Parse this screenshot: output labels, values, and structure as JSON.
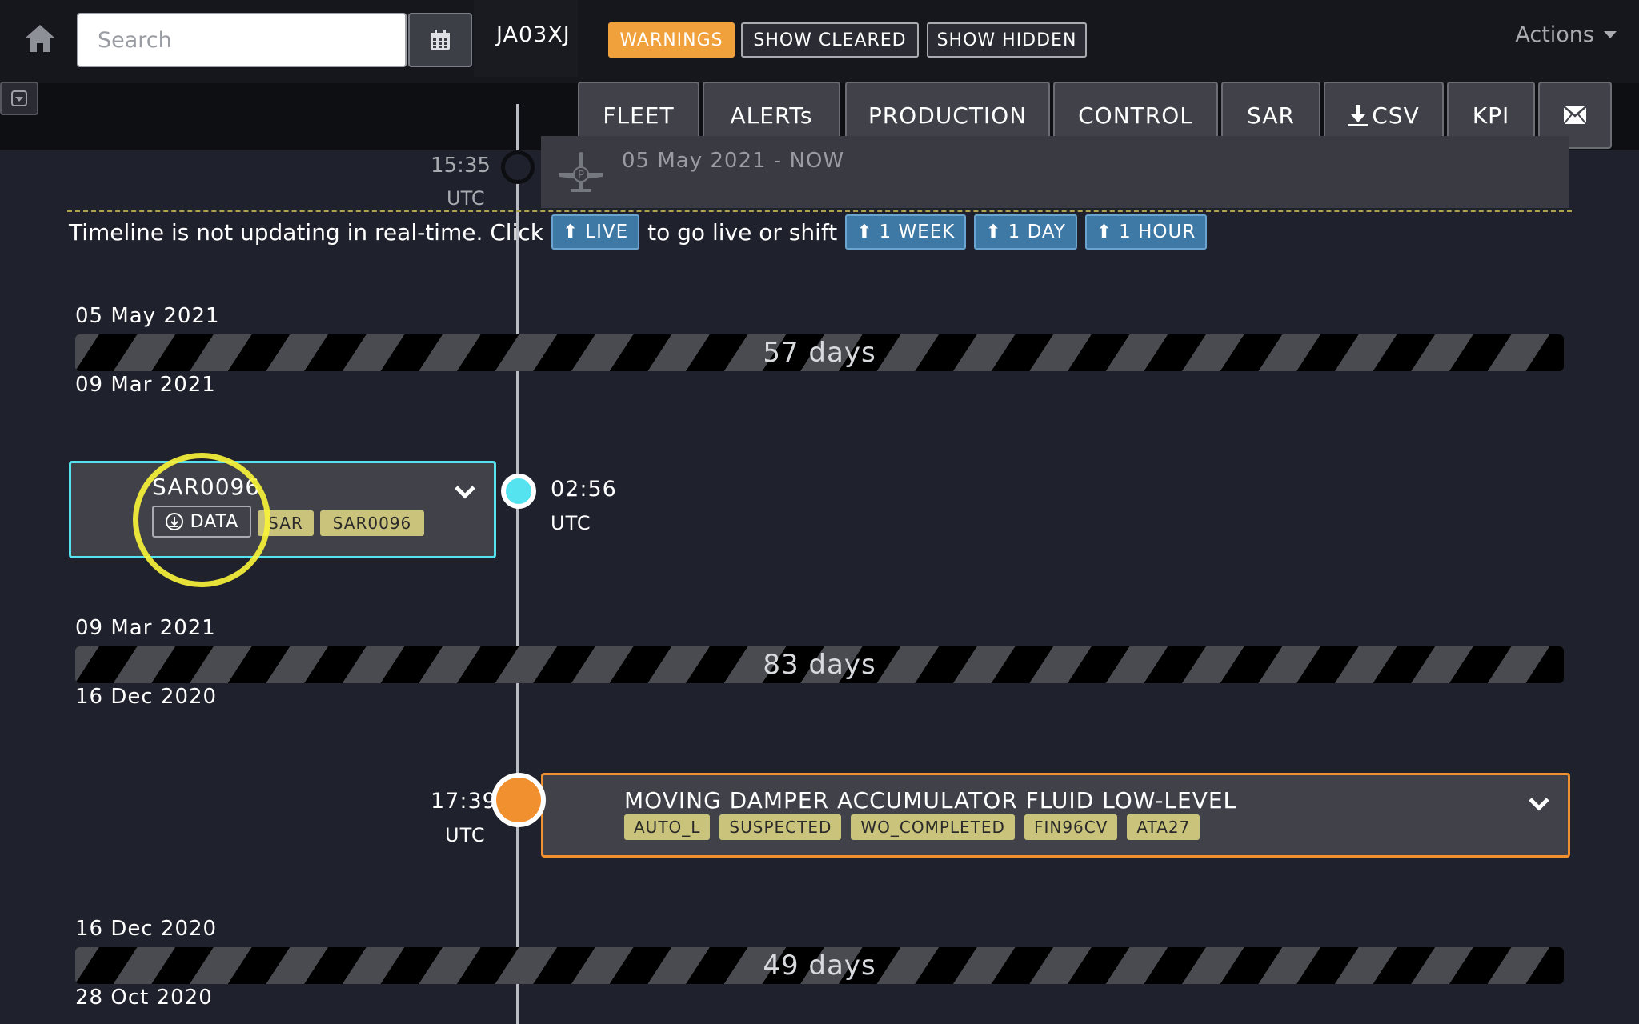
{
  "topbar": {
    "search_placeholder": "Search",
    "registration": "JA03XJ",
    "filters": {
      "warnings": "WARNINGS",
      "show_cleared": "SHOW CLEARED",
      "show_hidden": "SHOW HIDDEN"
    },
    "actions_label": "Actions",
    "colors": {
      "warnings": "#f0a13b",
      "background": "#16171d"
    }
  },
  "nav": {
    "buttons": [
      "FLEET",
      "ALERTs",
      "PRODUCTION",
      "CONTROL",
      "SAR",
      "CSV",
      "KPI"
    ]
  },
  "now_item": {
    "time": "15:35",
    "zone": "UTC",
    "title": "05 May 2021 - NOW"
  },
  "notice": {
    "text_before": "Timeline is not updating in real-time. Click",
    "live_label": "LIVE",
    "text_middle": "to go live or shift",
    "shift_week": "1 WEEK",
    "shift_day": "1 DAY",
    "shift_hour": "1 HOUR"
  },
  "gaps": [
    {
      "top_date": "05 May 2021",
      "bottom_date": "09 Mar 2021",
      "duration": "57 days"
    },
    {
      "top_date": "09 Mar 2021",
      "bottom_date": "16 Dec 2020",
      "duration": "83 days"
    },
    {
      "top_date": "16 Dec 2020",
      "bottom_date": "28 Oct 2020",
      "duration": "49 days"
    }
  ],
  "events": [
    {
      "title": "SAR0096",
      "data_label": "DATA",
      "tags": [
        "SAR",
        "SAR0096"
      ],
      "time": "02:56",
      "zone": "UTC",
      "color": "#55e3ef"
    },
    {
      "title": "MOVING DAMPER ACCUMULATOR FLUID LOW-LEVEL",
      "tags": [
        "AUTO_L",
        "SUSPECTED",
        "WO_COMPLETED",
        "FIN96CV",
        "ATA27"
      ],
      "time": "17:39",
      "zone": "UTC",
      "color": "#f0902e"
    }
  ]
}
